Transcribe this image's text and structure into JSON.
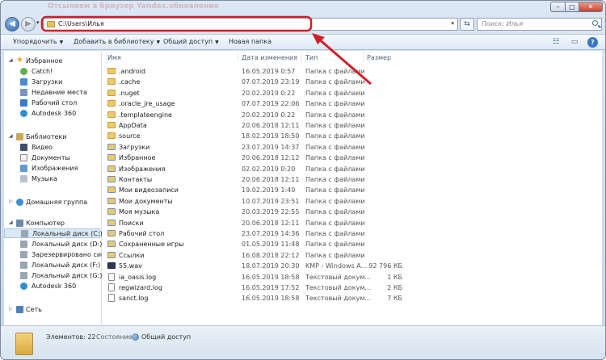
{
  "window": {
    "ghost_title": "Отсылаем в браузер Yandex.обновление",
    "controls": {
      "minimize": "–",
      "maximize": "□",
      "close": "✕"
    }
  },
  "address_bar": {
    "path": "C:\\Users\\Илья",
    "refresh_symbol": "⇆",
    "search_placeholder": "Поиск: Илья",
    "history_arrow": "▾",
    "dropdown_arrow": "▾"
  },
  "toolbar": {
    "organize": "Упорядочить",
    "add_to_library": "Добавить в библиотеку",
    "share": "Общий доступ",
    "new_folder": "Новая папка",
    "view_icon": "☷",
    "preview_icon": "▭",
    "help_icon": "?"
  },
  "navigation": {
    "favorites": {
      "label": "Избранное",
      "items": [
        "Catch!",
        "Загрузки",
        "Недавние места",
        "Рабочий стол",
        "Autodesk 360"
      ]
    },
    "libraries": {
      "label": "Библиотеки",
      "items": [
        "Видео",
        "Документы",
        "Изображения",
        "Музыка"
      ]
    },
    "homegroup": {
      "label": "Домашняя группа"
    },
    "computer": {
      "label": "Компьютер",
      "items": [
        "Локальный диск (C:)",
        "Локальный диск (D:)",
        "Зарезервировано систем",
        "Локальный диск (F:)",
        "Локальный диск (G:)",
        "Autodesk 360"
      ]
    },
    "network": {
      "label": "Сеть"
    }
  },
  "columns": {
    "name": "Имя",
    "date": "Дата изменения",
    "type": "Тип",
    "size": "Размер"
  },
  "files": [
    {
      "name": ".android",
      "date": "16.05.2019 0:57",
      "type": "Папка с файлами",
      "size": "",
      "kind": "folder"
    },
    {
      "name": ".cache",
      "date": "07.07.2019 23:19",
      "type": "Папка с файлами",
      "size": "",
      "kind": "folder"
    },
    {
      "name": ".nuget",
      "date": "20.02.2019 0:22",
      "type": "Папка с файлами",
      "size": "",
      "kind": "folder"
    },
    {
      "name": ".oracle_jre_usage",
      "date": "07.07.2019 22:06",
      "type": "Папка с файлами",
      "size": "",
      "kind": "folder"
    },
    {
      "name": ".templateengine",
      "date": "20.02.2019 0:22",
      "type": "Папка с файлами",
      "size": "",
      "kind": "folder"
    },
    {
      "name": "AppData",
      "date": "20.06.2018 12:11",
      "type": "Папка с файлами",
      "size": "",
      "kind": "folder"
    },
    {
      "name": "source",
      "date": "18.02.2019 18:50",
      "type": "Папка с файлами",
      "size": "",
      "kind": "folder"
    },
    {
      "name": "Загрузки",
      "date": "23.07.2019 14:37",
      "type": "Папка с файлами",
      "size": "",
      "kind": "special"
    },
    {
      "name": "Избранное",
      "date": "20.06.2018 12:12",
      "type": "Папка с файлами",
      "size": "",
      "kind": "special"
    },
    {
      "name": "Изображения",
      "date": "02.02.2019 0:20",
      "type": "Папка с файлами",
      "size": "",
      "kind": "special"
    },
    {
      "name": "Контакты",
      "date": "20.06.2018 12:11",
      "type": "Папка с файлами",
      "size": "",
      "kind": "special"
    },
    {
      "name": "Мои видеозаписи",
      "date": "19.02.2019 1:40",
      "type": "Папка с файлами",
      "size": "",
      "kind": "special"
    },
    {
      "name": "Мои документы",
      "date": "10.07.2019 23:51",
      "type": "Папка с файлами",
      "size": "",
      "kind": "special"
    },
    {
      "name": "Моя музыка",
      "date": "20.03.2019 22:55",
      "type": "Папка с файлами",
      "size": "",
      "kind": "special"
    },
    {
      "name": "Поиски",
      "date": "20.06.2018 12:11",
      "type": "Папка с файлами",
      "size": "",
      "kind": "special"
    },
    {
      "name": "Рабочий стол",
      "date": "23.07.2019 14:36",
      "type": "Папка с файлами",
      "size": "",
      "kind": "special"
    },
    {
      "name": "Сохраненные игры",
      "date": "01.05.2019 11:48",
      "type": "Папка с файлами",
      "size": "",
      "kind": "special"
    },
    {
      "name": "Ссылки",
      "date": "16.08.2018 22:12",
      "type": "Папка с файлами",
      "size": "",
      "kind": "special"
    },
    {
      "name": "55.wav",
      "date": "18.07.2019 20:30",
      "type": "KMP - Windows A...",
      "size": "92 796 КБ",
      "kind": "media"
    },
    {
      "name": "ia_oasis.log",
      "date": "16.05.2019 18:58",
      "type": "Текстовый докум...",
      "size": "1 КБ",
      "kind": "file"
    },
    {
      "name": "regwizard.log",
      "date": "16.05.2019 17:52",
      "type": "Текстовый докум...",
      "size": "2 КБ",
      "kind": "file"
    },
    {
      "name": "sanct.log",
      "date": "16.05.2019 18:58",
      "type": "Текстовый докум...",
      "size": "7 КБ",
      "kind": "file"
    }
  ],
  "status": {
    "items_count": "Элементов: 22",
    "state_label": "Состояние:",
    "state_value": "Общий доступ"
  },
  "colors": {
    "highlight": "#d0202a",
    "selection": "#dbe9f7",
    "folder": "#eec969"
  }
}
